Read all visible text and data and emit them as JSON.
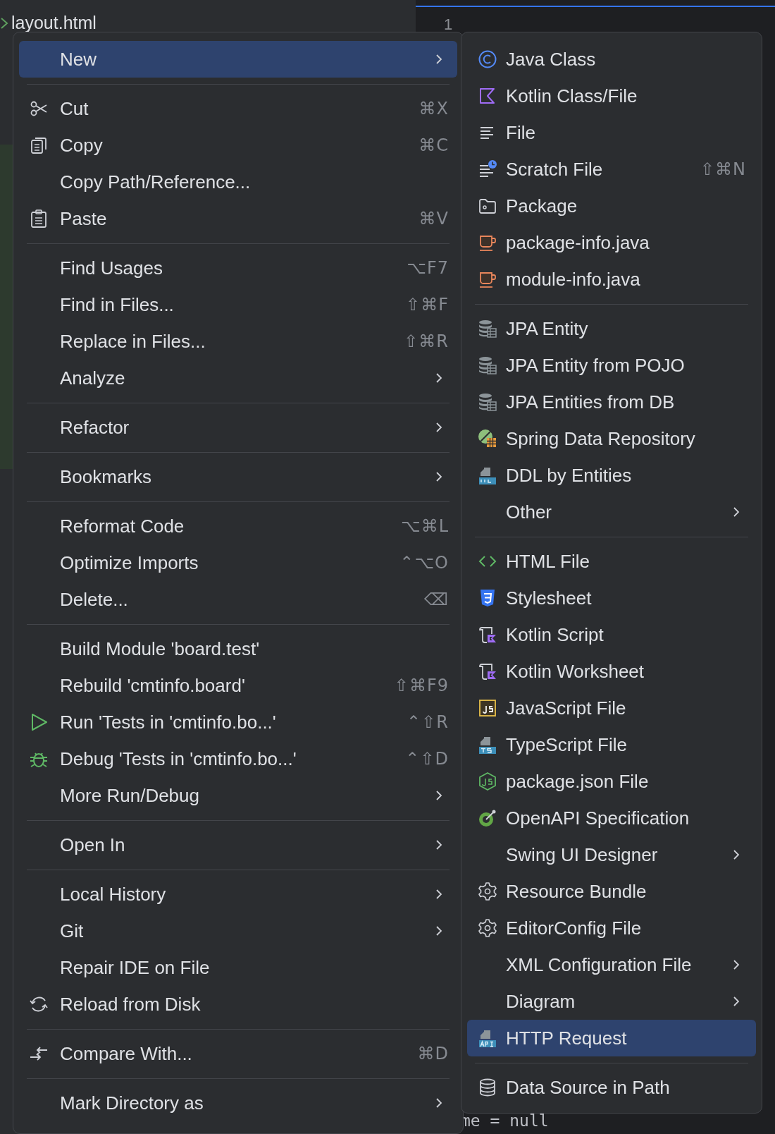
{
  "background": {
    "tree_item": "layout.html",
    "line_number": "1",
    "code": "me = null"
  },
  "context_menu": {
    "groups": [
      [
        {
          "label": "New",
          "kind": "plain",
          "has_submenu": true,
          "selected": true
        }
      ],
      [
        {
          "label": "Cut",
          "shortcut": "⌘X",
          "kind": "scissors",
          "has_submenu": false,
          "selected": false
        },
        {
          "label": "Copy",
          "shortcut": "⌘C",
          "kind": "copy",
          "has_submenu": false,
          "selected": false
        },
        {
          "label": "Copy Path/Reference...",
          "kind": "plain",
          "has_submenu": false,
          "selected": false
        },
        {
          "label": "Paste",
          "shortcut": "⌘V",
          "kind": "paste",
          "has_submenu": false,
          "selected": false
        }
      ],
      [
        {
          "label": "Find Usages",
          "shortcut": "⌥F7",
          "kind": "plain",
          "has_submenu": false,
          "selected": false
        },
        {
          "label": "Find in Files...",
          "shortcut": "⇧⌘F",
          "kind": "plain",
          "has_submenu": false,
          "selected": false
        },
        {
          "label": "Replace in Files...",
          "shortcut": "⇧⌘R",
          "kind": "plain",
          "has_submenu": false,
          "selected": false
        },
        {
          "label": "Analyze",
          "kind": "plain",
          "has_submenu": true,
          "selected": false
        }
      ],
      [
        {
          "label": "Refactor",
          "kind": "plain",
          "has_submenu": true,
          "selected": false
        }
      ],
      [
        {
          "label": "Bookmarks",
          "kind": "plain",
          "has_submenu": true,
          "selected": false
        }
      ],
      [
        {
          "label": "Reformat Code",
          "shortcut": "⌥⌘L",
          "kind": "plain",
          "has_submenu": false,
          "selected": false
        },
        {
          "label": "Optimize Imports",
          "shortcut": "⌃⌥O",
          "kind": "plain",
          "has_submenu": false,
          "selected": false
        },
        {
          "label": "Delete...",
          "shortcut": "⌫",
          "kind": "plain",
          "has_submenu": false,
          "selected": false
        }
      ],
      [
        {
          "label": "Build Module 'board.test'",
          "kind": "plain",
          "has_submenu": false,
          "selected": false
        },
        {
          "label": "Rebuild 'cmtinfo.board'",
          "shortcut": "⇧⌘F9",
          "kind": "plain",
          "has_submenu": false,
          "selected": false
        },
        {
          "label": "Run 'Tests in 'cmtinfo.bo...'",
          "shortcut": "⌃⇧R",
          "kind": "play",
          "has_submenu": false,
          "selected": false
        },
        {
          "label": "Debug 'Tests in 'cmtinfo.bo...'",
          "shortcut": "⌃⇧D",
          "kind": "bug",
          "has_submenu": false,
          "selected": false
        },
        {
          "label": "More Run/Debug",
          "kind": "plain",
          "has_submenu": true,
          "selected": false
        }
      ],
      [
        {
          "label": "Open In",
          "kind": "plain",
          "has_submenu": true,
          "selected": false
        }
      ],
      [
        {
          "label": "Local History",
          "kind": "plain",
          "has_submenu": true,
          "selected": false
        },
        {
          "label": "Git",
          "kind": "plain",
          "has_submenu": true,
          "selected": false
        },
        {
          "label": "Repair IDE on File",
          "kind": "plain",
          "has_submenu": false,
          "selected": false
        },
        {
          "label": "Reload from Disk",
          "kind": "reload",
          "has_submenu": false,
          "selected": false
        }
      ],
      [
        {
          "label": "Compare With...",
          "shortcut": "⌘D",
          "kind": "compare",
          "has_submenu": false,
          "selected": false
        }
      ],
      [
        {
          "label": "Mark Directory as",
          "kind": "plain",
          "has_submenu": true,
          "selected": false
        }
      ]
    ]
  },
  "new_submenu": {
    "groups": [
      [
        {
          "label": "Java Class",
          "kind": "java-class",
          "has_submenu": false,
          "selected": false
        },
        {
          "label": "Kotlin Class/File",
          "kind": "kotlin",
          "has_submenu": false,
          "selected": false
        },
        {
          "label": "File",
          "kind": "file",
          "has_submenu": false,
          "selected": false
        },
        {
          "label": "Scratch File",
          "shortcut": "⇧⌘N",
          "kind": "scratch",
          "has_submenu": false,
          "selected": false
        },
        {
          "label": "Package",
          "kind": "folder",
          "has_submenu": false,
          "selected": false
        },
        {
          "label": "package-info.java",
          "kind": "cup",
          "has_submenu": false,
          "selected": false
        },
        {
          "label": "module-info.java",
          "kind": "cup",
          "has_submenu": false,
          "selected": false
        }
      ],
      [
        {
          "label": "JPA Entity",
          "kind": "db-table",
          "has_submenu": false,
          "selected": false
        },
        {
          "label": "JPA Entity from POJO",
          "kind": "db-table",
          "has_submenu": false,
          "selected": false
        },
        {
          "label": "JPA Entities from DB",
          "kind": "db-table",
          "has_submenu": false,
          "selected": false
        },
        {
          "label": "Spring Data Repository",
          "kind": "spring",
          "has_submenu": false,
          "selected": false
        },
        {
          "label": "DDL by Entities",
          "kind": "ddl",
          "has_submenu": false,
          "selected": false
        },
        {
          "label": "Other",
          "kind": "plain",
          "has_submenu": true,
          "selected": false
        }
      ],
      [
        {
          "label": "HTML File",
          "kind": "html",
          "has_submenu": false,
          "selected": false
        },
        {
          "label": "Stylesheet",
          "kind": "css",
          "has_submenu": false,
          "selected": false
        },
        {
          "label": "Kotlin Script",
          "kind": "kotlin-script",
          "has_submenu": false,
          "selected": false
        },
        {
          "label": "Kotlin Worksheet",
          "kind": "kotlin-script",
          "has_submenu": false,
          "selected": false
        },
        {
          "label": "JavaScript File",
          "kind": "js",
          "has_submenu": false,
          "selected": false
        },
        {
          "label": "TypeScript File",
          "kind": "ts",
          "has_submenu": false,
          "selected": false
        },
        {
          "label": "package.json File",
          "kind": "node",
          "has_submenu": false,
          "selected": false
        },
        {
          "label": "OpenAPI Specification",
          "kind": "openapi",
          "has_submenu": false,
          "selected": false
        },
        {
          "label": "Swing UI Designer",
          "kind": "plain",
          "has_submenu": true,
          "selected": false
        },
        {
          "label": "Resource Bundle",
          "kind": "gear",
          "has_submenu": false,
          "selected": false
        },
        {
          "label": "EditorConfig File",
          "kind": "gear",
          "has_submenu": false,
          "selected": false
        },
        {
          "label": "XML Configuration File",
          "kind": "plain",
          "has_submenu": true,
          "selected": false
        },
        {
          "label": "Diagram",
          "kind": "plain",
          "has_submenu": true,
          "selected": false
        },
        {
          "label": "HTTP Request",
          "kind": "api",
          "has_submenu": false,
          "selected": true
        }
      ],
      [
        {
          "label": "Data Source in Path",
          "kind": "database",
          "has_submenu": false,
          "selected": false
        }
      ]
    ]
  }
}
